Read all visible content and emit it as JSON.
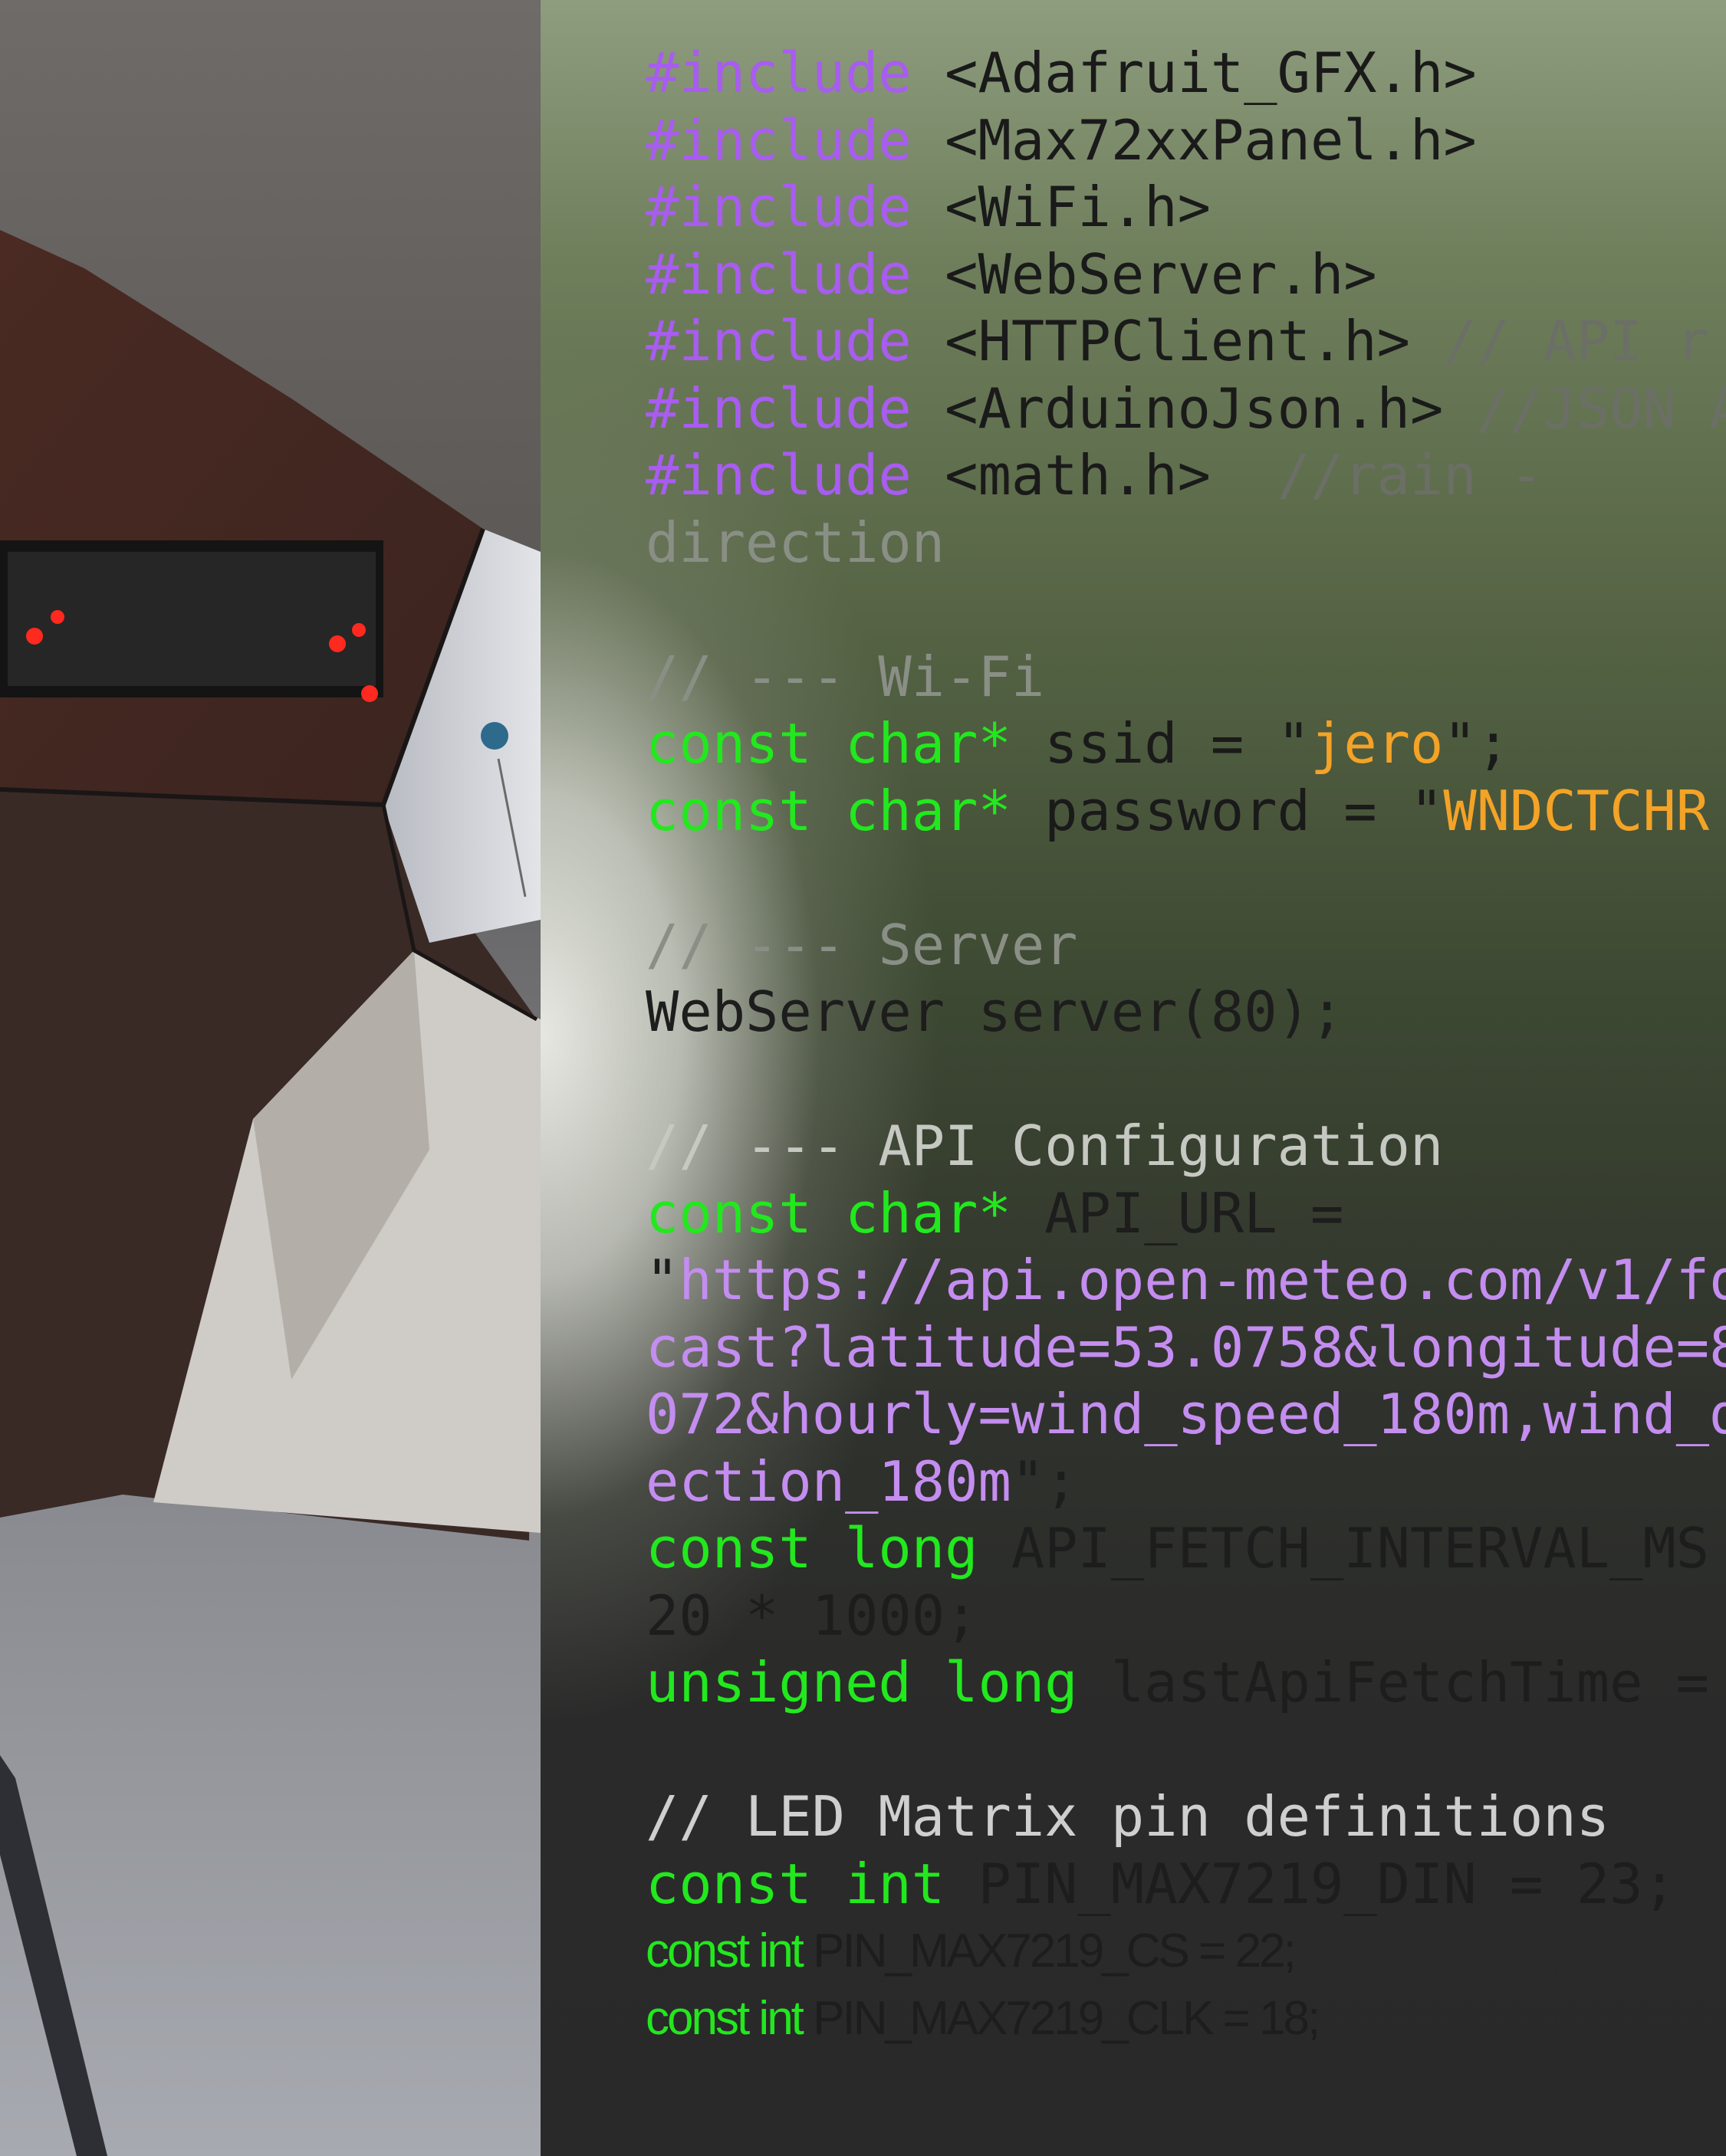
{
  "code_lines": [
    {
      "kw": "#include",
      "text": " <Adafruit_GFX.h>"
    },
    {
      "kw": "#include",
      "text": " <Max72xxPanel.h>"
    },
    {
      "kw": "#include",
      "text": " <WiFi.h>"
    },
    {
      "kw": "#include",
      "text": " <WebServer.h>"
    },
    {
      "kw": "#include",
      "text": " <HTTPClient.h>",
      "comment": " // API r"
    },
    {
      "kw": "#include",
      "text": " <ArduinoJson.h>",
      "comment": " //JSON A"
    },
    {
      "kw": "#include",
      "text": " <math.h>",
      "comment": "  //rain -"
    },
    {
      "text": "direction"
    },
    {
      "text": ""
    },
    {
      "comment": "// --- Wi-Fi"
    },
    {
      "type": "const char*",
      "text": " ssid = \"",
      "str": "jero",
      "tail": "\";"
    },
    {
      "type": "const char*",
      "text": " password = \"",
      "str": "WNDCTCHR"
    },
    {
      "text": ""
    },
    {
      "comment": "// --- Server"
    },
    {
      "text": "WebServer server(80);"
    },
    {
      "text": ""
    },
    {
      "comment": "// --- API Configuration"
    },
    {
      "type": "const char*",
      "text": " API_URL ="
    },
    {
      "text": "\"",
      "url": "https://api.open-meteo.com/v1/fo"
    },
    {
      "url": "cast?latitude=53.0758&longitude=8"
    },
    {
      "url": "072&hourly=wind_speed_180m,wind_d"
    },
    {
      "url": "ection_180m",
      "tail": "\";"
    },
    {
      "type": "const long",
      "text": " API_FETCH_INTERVAL_MS"
    },
    {
      "text": "20 * 1000;"
    },
    {
      "type": "unsigned long",
      "text": " lastApiFetchTime ="
    },
    {
      "text": ""
    },
    {
      "comment": "// LED Matrix pin definitions"
    },
    {
      "type": "const int",
      "text": " PIN_MAX7219_DIN = 23;"
    },
    {
      "type": "const int",
      "text": " PIN_MAX7219_CS = 22;"
    },
    {
      "type": "const int",
      "text": " PIN_MAX7219_CLK = 18;"
    }
  ]
}
